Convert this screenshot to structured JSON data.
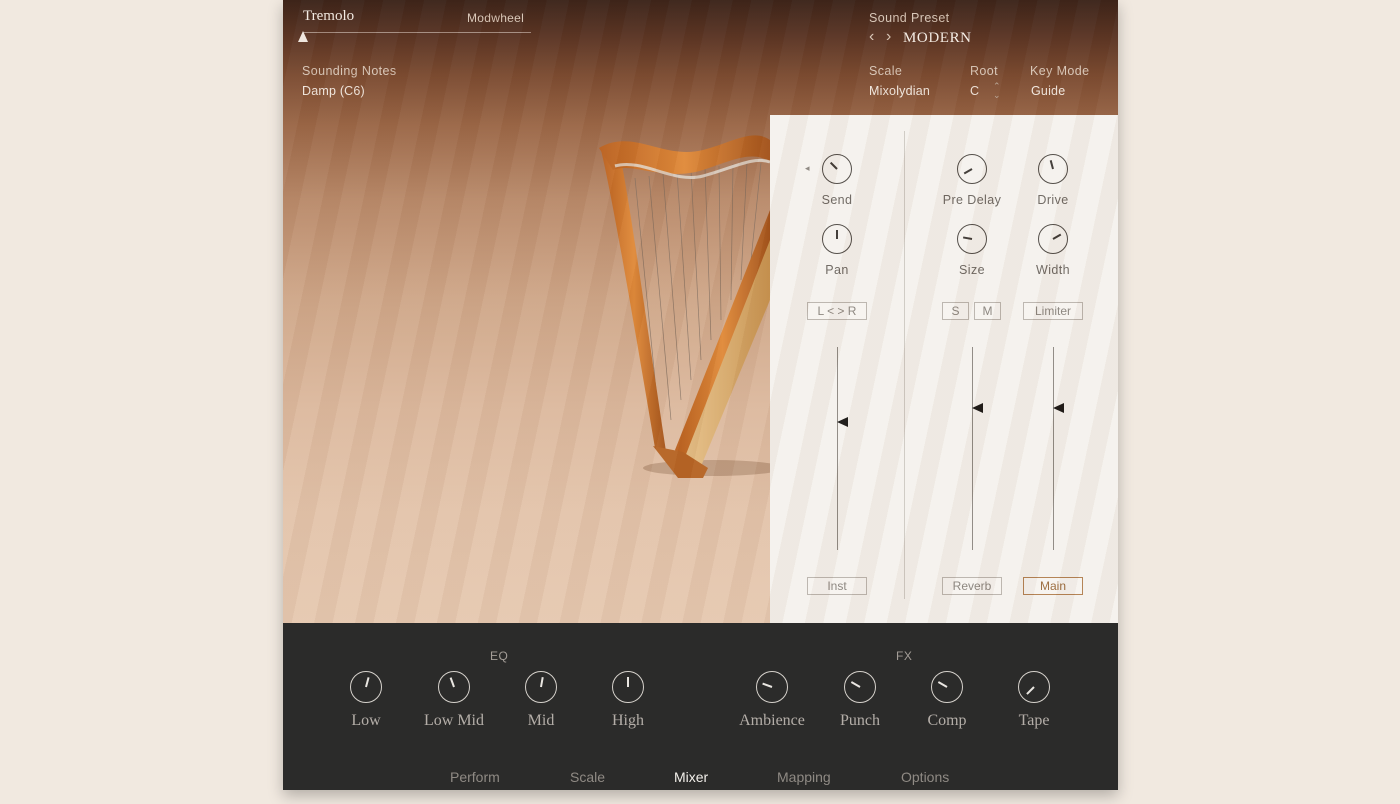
{
  "header": {
    "tremolo_label": "Tremolo",
    "modwheel_label": "Modwheel",
    "tremolo_level": 0.0,
    "sounding_notes_label": "Sounding Notes",
    "sounding_notes_value": "Damp (C6)",
    "sound_preset_label": "Sound Preset",
    "sound_preset_value": "MODERN",
    "prev_glyph": "‹",
    "next_glyph": "›",
    "scale_label": "Scale",
    "scale_value": "Mixolydian",
    "root_label": "Root",
    "root_value": "C",
    "key_mode_label": "Key Mode",
    "key_mode_value": "Guide"
  },
  "mixer": {
    "inst": {
      "send_label": "Send",
      "pan_label": "Pan",
      "lr_button": "L < > R",
      "channel_button": "Inst",
      "send_angle_deg": -45,
      "pan_angle_deg": 0,
      "fader_level": 0.63
    },
    "reverb": {
      "pre_delay_label": "Pre Delay",
      "size_label": "Size",
      "solo_button": "S",
      "mute_button": "M",
      "channel_button": "Reverb",
      "pre_delay_angle_deg": -120,
      "size_angle_deg": -80,
      "fader_level": 0.7
    },
    "main": {
      "drive_label": "Drive",
      "width_label": "Width",
      "limiter_button": "Limiter",
      "channel_button": "Main",
      "drive_angle_deg": -15,
      "width_angle_deg": 60,
      "fader_level": 0.7
    }
  },
  "eq": {
    "title": "EQ",
    "knobs": [
      {
        "label": "Low",
        "angle": 15
      },
      {
        "label": "Low Mid",
        "angle": -20
      },
      {
        "label": "Mid",
        "angle": 10
      },
      {
        "label": "High",
        "angle": 0
      }
    ]
  },
  "fx": {
    "title": "FX",
    "knobs": [
      {
        "label": "Ambience",
        "angle": -70
      },
      {
        "label": "Punch",
        "angle": -60
      },
      {
        "label": "Comp",
        "angle": -60
      },
      {
        "label": "Tape",
        "angle": -135
      }
    ]
  },
  "tabs": [
    "Perform",
    "Scale",
    "Mixer",
    "Mapping",
    "Options"
  ],
  "active_tab": "Mixer",
  "colors": {
    "active_button": "#b38152",
    "bottom_bg": "#2b2b2a",
    "mixer_bg": "#f5f2ed",
    "page_bg": "#f1e9e0"
  }
}
